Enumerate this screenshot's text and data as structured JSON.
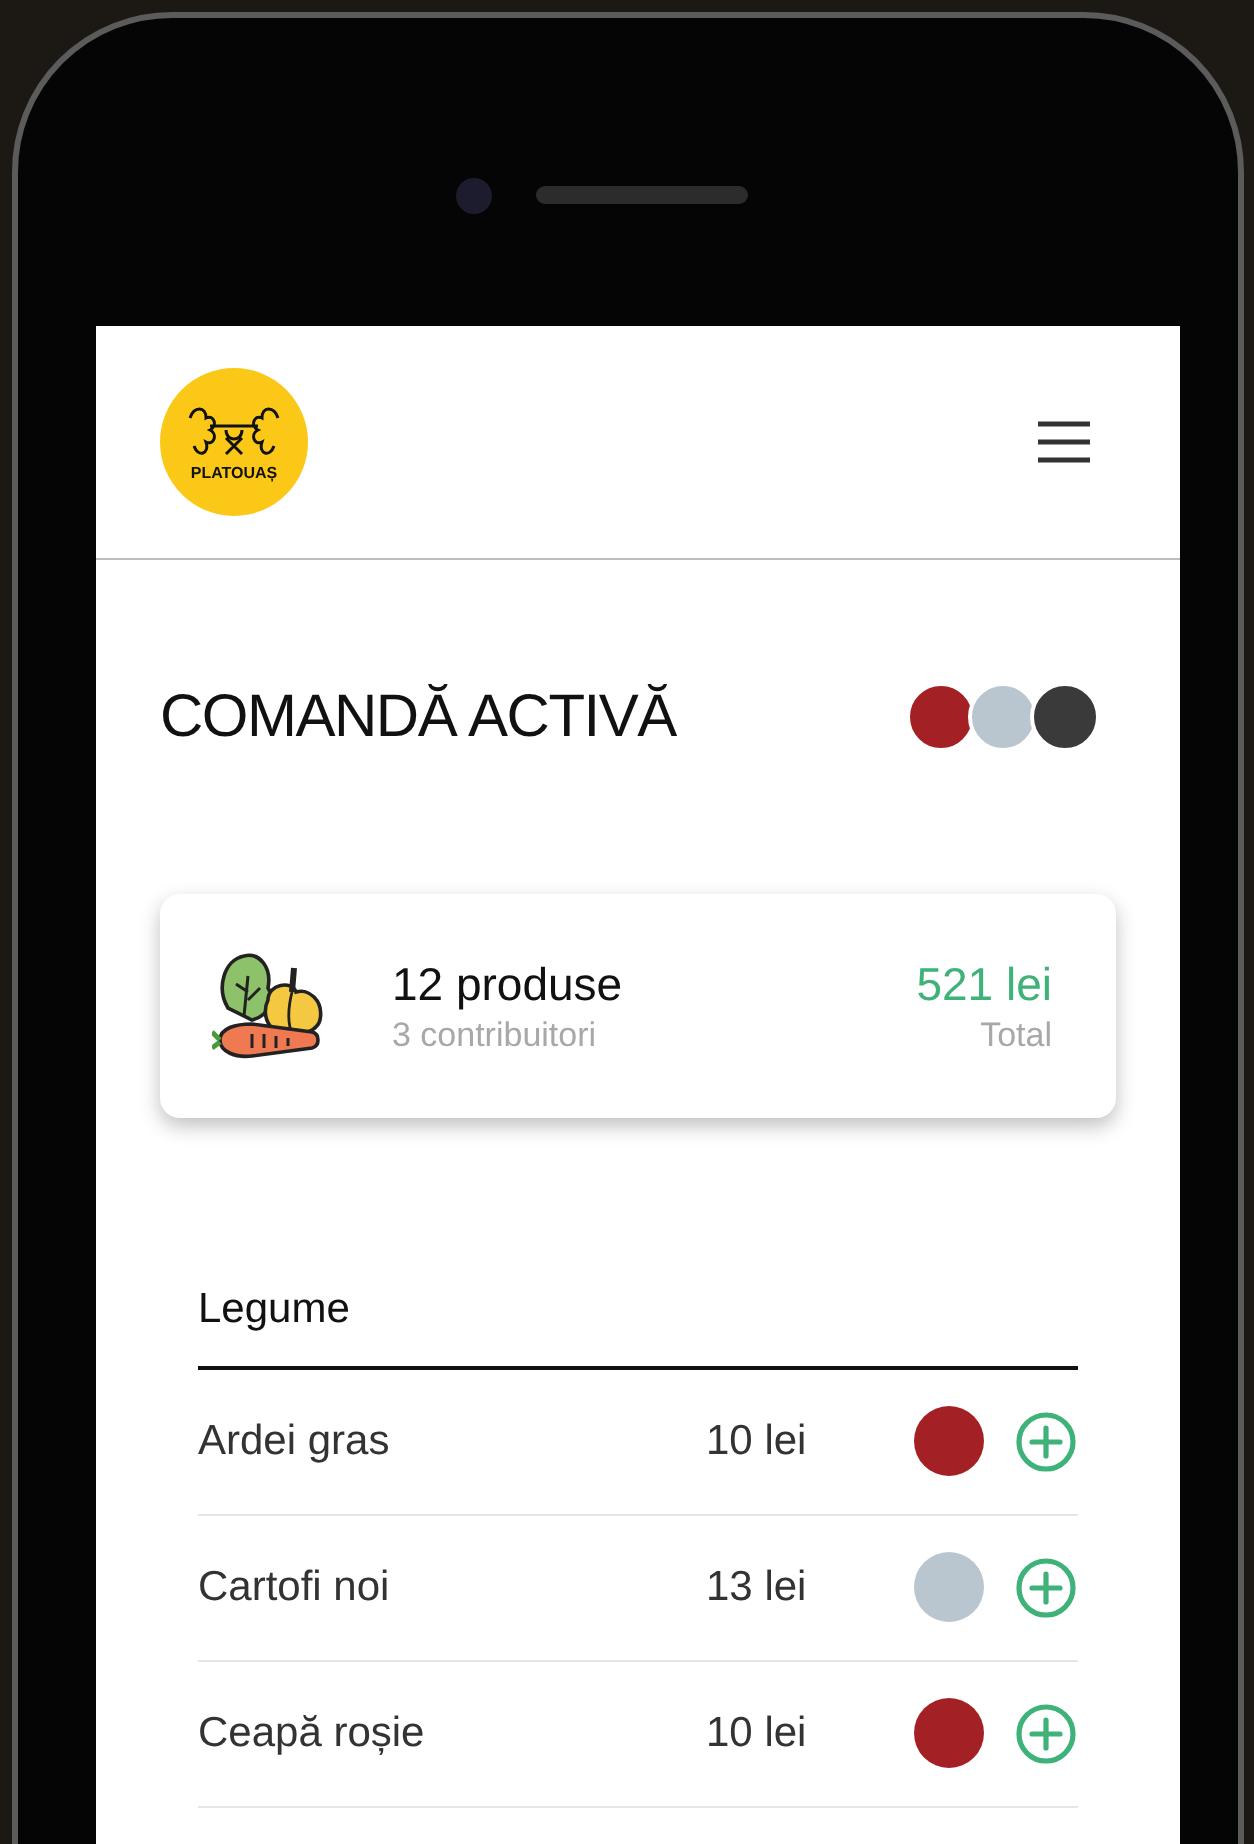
{
  "header": {
    "logo_text": "PLATOUAȘ"
  },
  "order": {
    "title": "COMANDĂ ACTIVĂ",
    "contributors": [
      {
        "color": "#a32025"
      },
      {
        "color": "#b9c6cf"
      },
      {
        "color": "#3a3a3a"
      }
    ]
  },
  "summary": {
    "products": "12 produse",
    "contributors": "3 contribuitori",
    "amount": "521 lei",
    "amount_label": "Total"
  },
  "category": {
    "title": "Legume",
    "rows": [
      {
        "name": "Ardei gras",
        "price": "10 lei",
        "color": "#a32025"
      },
      {
        "name": "Cartofi noi",
        "price": "13 lei",
        "color": "#b9c6cf"
      },
      {
        "name": "Ceapă roșie",
        "price": "10 lei",
        "color": "#a32025"
      }
    ]
  }
}
